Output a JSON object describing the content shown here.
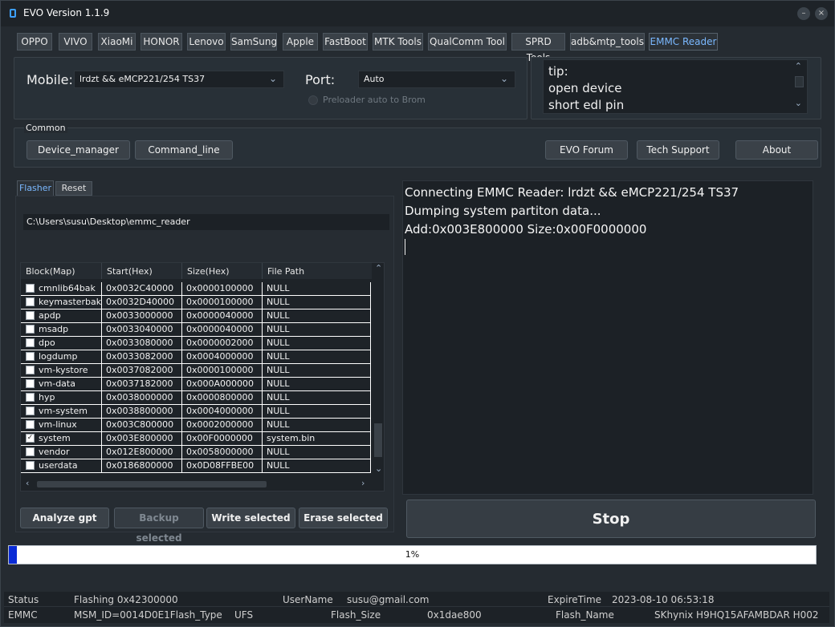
{
  "window": {
    "title": "EVO Version 1.1.9",
    "min_icon": "minimize-icon",
    "close_icon": "close-icon",
    "min_glyph": "–",
    "close_glyph": "×"
  },
  "tabs": [
    "OPPO",
    "VIVO",
    "XiaoMi",
    "HONOR",
    "Lenovo",
    "SamSung",
    "Apple",
    "FastBoot",
    "MTK Tools",
    "QualComm Tool",
    "SPRD Tools",
    "adb&mtp_tools",
    "EMMC Reader"
  ],
  "active_tab": "EMMC Reader",
  "mobile": {
    "label": "Mobile:",
    "value": "lrdzt  &&  eMCP221/254 TS37"
  },
  "port": {
    "label": "Port:",
    "value": "Auto"
  },
  "preloader": {
    "label": "Preloader auto to Brom"
  },
  "tip": {
    "lines": [
      "tip:",
      "open device",
      "short edl pin"
    ]
  },
  "common": {
    "label": "Common",
    "device_manager": "Device_manager",
    "command_line": "Command_line",
    "evo_forum": "EVO Forum",
    "tech_support": "Tech Support",
    "about": "About"
  },
  "subtabs": {
    "flasher": "Flasher",
    "reset": "Reset"
  },
  "path": {
    "value": "C:\\Users\\susu\\Desktop\\emmc_reader"
  },
  "grid": {
    "headers": [
      "Block(Map)",
      "Start(Hex)",
      "Size(Hex)",
      "File Path"
    ],
    "rows": [
      {
        "name": "cmnlib64bak",
        "start": "0x0032C40000",
        "size": "0x0000100000",
        "file": "NULL",
        "checked": false
      },
      {
        "name": "keymasterbak",
        "start": "0x0032D40000",
        "size": "0x0000100000",
        "file": "NULL",
        "checked": false
      },
      {
        "name": "apdp",
        "start": "0x0033000000",
        "size": "0x0000040000",
        "file": "NULL",
        "checked": false
      },
      {
        "name": "msadp",
        "start": "0x0033040000",
        "size": "0x0000040000",
        "file": "NULL",
        "checked": false
      },
      {
        "name": "dpo",
        "start": "0x0033080000",
        "size": "0x0000002000",
        "file": "NULL",
        "checked": false
      },
      {
        "name": "logdump",
        "start": "0x0033082000",
        "size": "0x0004000000",
        "file": "NULL",
        "checked": false
      },
      {
        "name": "vm-kystore",
        "start": "0x0037082000",
        "size": "0x0000100000",
        "file": "NULL",
        "checked": false
      },
      {
        "name": "vm-data",
        "start": "0x0037182000",
        "size": "0x000A000000",
        "file": "NULL",
        "checked": false
      },
      {
        "name": "hyp",
        "start": "0x0038000000",
        "size": "0x0000800000",
        "file": "NULL",
        "checked": false
      },
      {
        "name": "vm-system",
        "start": "0x0038800000",
        "size": "0x0004000000",
        "file": "NULL",
        "checked": false
      },
      {
        "name": "vm-linux",
        "start": "0x003C800000",
        "size": "0x0002000000",
        "file": "NULL",
        "checked": false
      },
      {
        "name": "system",
        "start": "0x003E800000",
        "size": "0x00F0000000",
        "file": "system.bin",
        "checked": true
      },
      {
        "name": "vendor",
        "start": "0x012E800000",
        "size": "0x0058000000",
        "file": "NULL",
        "checked": false
      },
      {
        "name": "userdata",
        "start": "0x0186800000",
        "size": "0x0D08FFBE00",
        "file": "NULL",
        "checked": false
      }
    ]
  },
  "actions": {
    "analyze": "Analyze gpt",
    "backup": "Backup selected",
    "write": "Write selected",
    "erase": "Erase selected",
    "stop": "Stop"
  },
  "log": {
    "lines": [
      "Connecting EMMC Reader: lrdzt   &&  eMCP221/254 TS37",
      "Dumping system partiton data...",
      "Add:0x003E800000 Size:0x00F0000000"
    ]
  },
  "progress": {
    "text": "1%",
    "value": 1
  },
  "statusbar": {
    "status_label": "Status",
    "status_value": "Flashing 0x42300000",
    "username_label": "UserName",
    "username_value": "susu@gmail.com",
    "expire_label": "ExpireTime",
    "expire_value": "2023-08-10 06:53:18",
    "emmc_label": "EMMC",
    "msm_value": "MSM_ID=0014D0E1Flash_Type",
    "flash_type_value": "UFS",
    "flash_size_label": "Flash_Size",
    "flash_size_value": "0x1dae800",
    "flash_name_label": "Flash_Name",
    "flash_name_value": "SKhynix H9HQ15AFAMBDAR  H002"
  },
  "colors": {
    "accent": "#7ab8ff",
    "progress": "#0a2bd6",
    "background": "#252b31"
  }
}
